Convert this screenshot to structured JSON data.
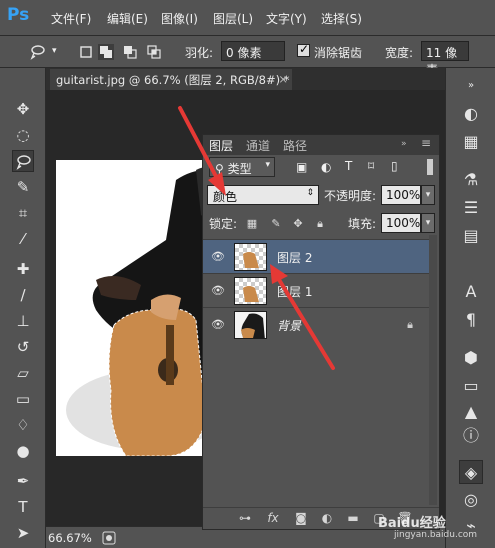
{
  "app": {
    "logo": "Ps",
    "menu": [
      "文件(F)",
      "编辑(E)",
      "图像(I)",
      "图层(L)",
      "文字(Y)",
      "选择(S)"
    ]
  },
  "options": {
    "feather_label": "羽化:",
    "feather_value": "0 像素",
    "antialias_label": "消除锯齿",
    "width_label": "宽度:",
    "width_value": "11 像素"
  },
  "document": {
    "tab_title": "guitarist.jpg @ 66.7% (图层 2, RGB/8#)",
    "tab_modified": "*",
    "tab_close": "×"
  },
  "status": {
    "zoom": "66.67%"
  },
  "layers_panel": {
    "tabs": [
      "图层",
      "通道",
      "路径"
    ],
    "active_tab": "图层",
    "filter_kind": "类型",
    "blend_mode": "颜色",
    "opacity_label": "不透明度:",
    "opacity_value": "100%",
    "lock_label": "锁定:",
    "fill_label": "填充:",
    "fill_value": "100%",
    "layers": [
      {
        "name": "图层 2",
        "selected": true,
        "locked": false
      },
      {
        "name": "图层 1",
        "selected": false,
        "locked": false
      },
      {
        "name": "背景",
        "selected": false,
        "locked": true
      }
    ]
  },
  "colors": {
    "annotation_arrow": "#e53935",
    "selected_layer": "#4f6480",
    "guitar": "#c98a4b"
  },
  "watermark": {
    "text": "Baidu经验",
    "sub": "jingyan.baidu.com"
  }
}
